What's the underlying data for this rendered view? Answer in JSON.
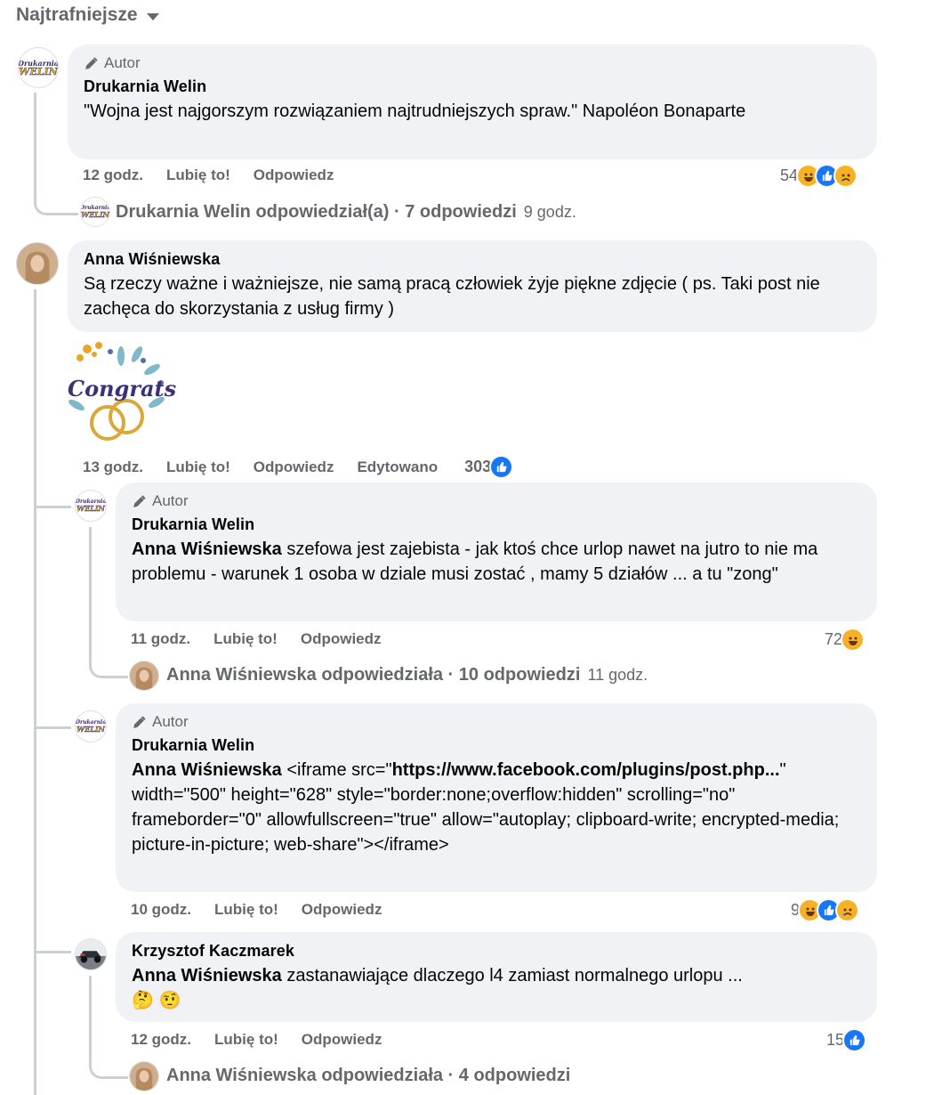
{
  "sort": {
    "label": "Najtrafniejsze"
  },
  "comments": [
    {
      "author_badge": "Autor",
      "name": "Drukarnia Welin",
      "text": "\"Wojna jest najgorszym rozwiązaniem najtrudniejszych spraw.\" Napoléon Bonaparte",
      "time": "12 godz.",
      "like": "Lubię to!",
      "reply": "Odpowiedz",
      "reaction_count": "54",
      "replies_line": {
        "who": "Drukarnia Welin odpowiedział(a) · 7 odpowiedzi",
        "time": "9 godz."
      }
    },
    {
      "name": "Anna Wiśniewska",
      "text": "Są rzeczy ważne i ważniejsze, nie samą pracą człowiek żyje piękne zdjęcie ( ps. Taki post nie zachęca do skorzystania z usług firmy )",
      "sticker_text": "Congrats",
      "time": "13 godz.",
      "like": "Lubię to!",
      "reply": "Odpowiedz",
      "edited": "Edytowano",
      "reaction_count": "303"
    }
  ],
  "replies": [
    {
      "author_badge": "Autor",
      "name": "Drukarnia Welin",
      "mention": "Anna Wiśniewska",
      "text": " szefowa jest zajebista - jak ktoś chce urlop nawet na jutro to nie ma problemu - warunek 1 osoba w dziale musi zostać , mamy 5 działów ... a tu \"zong\"",
      "time": "11 godz.",
      "like": "Lubię to!",
      "reply": "Odpowiedz",
      "reaction_count": "72",
      "replies_line": {
        "who": "Anna Wiśniewska odpowiedziała · 10 odpowiedzi",
        "time": "11 godz."
      }
    },
    {
      "author_badge": "Autor",
      "name": "Drukarnia Welin",
      "mention": "Anna Wiśniewska",
      "text_pre": " <iframe src=\"",
      "link": "https://www.facebook.com/plugins/post.php...",
      "text_post": "\" width=\"500\" height=\"628\" style=\"border:none;overflow:hidden\" scrolling=\"no\" frameborder=\"0\" allowfullscreen=\"true\" allow=\"autoplay; clipboard-write; encrypted-media; picture-in-picture; web-share\"></iframe>",
      "time": "10 godz.",
      "like": "Lubię to!",
      "reply": "Odpowiedz",
      "reaction_count": "9"
    },
    {
      "name": "Krzysztof Kaczmarek",
      "mention": "Anna Wiśniewska",
      "text": " zastanawiające dlaczego l4 zamiast normalnego urlopu ...",
      "emojis": "🤔 🤨",
      "time": "12 godz.",
      "like": "Lubię to!",
      "reply": "Odpowiedz",
      "reaction_count": "15",
      "replies_line": {
        "who": "Anna Wiśniewska odpowiedziała · 4 odpowiedzi"
      }
    }
  ],
  "logo": {
    "line1": "Drukarnia",
    "line2": "WELIN"
  }
}
